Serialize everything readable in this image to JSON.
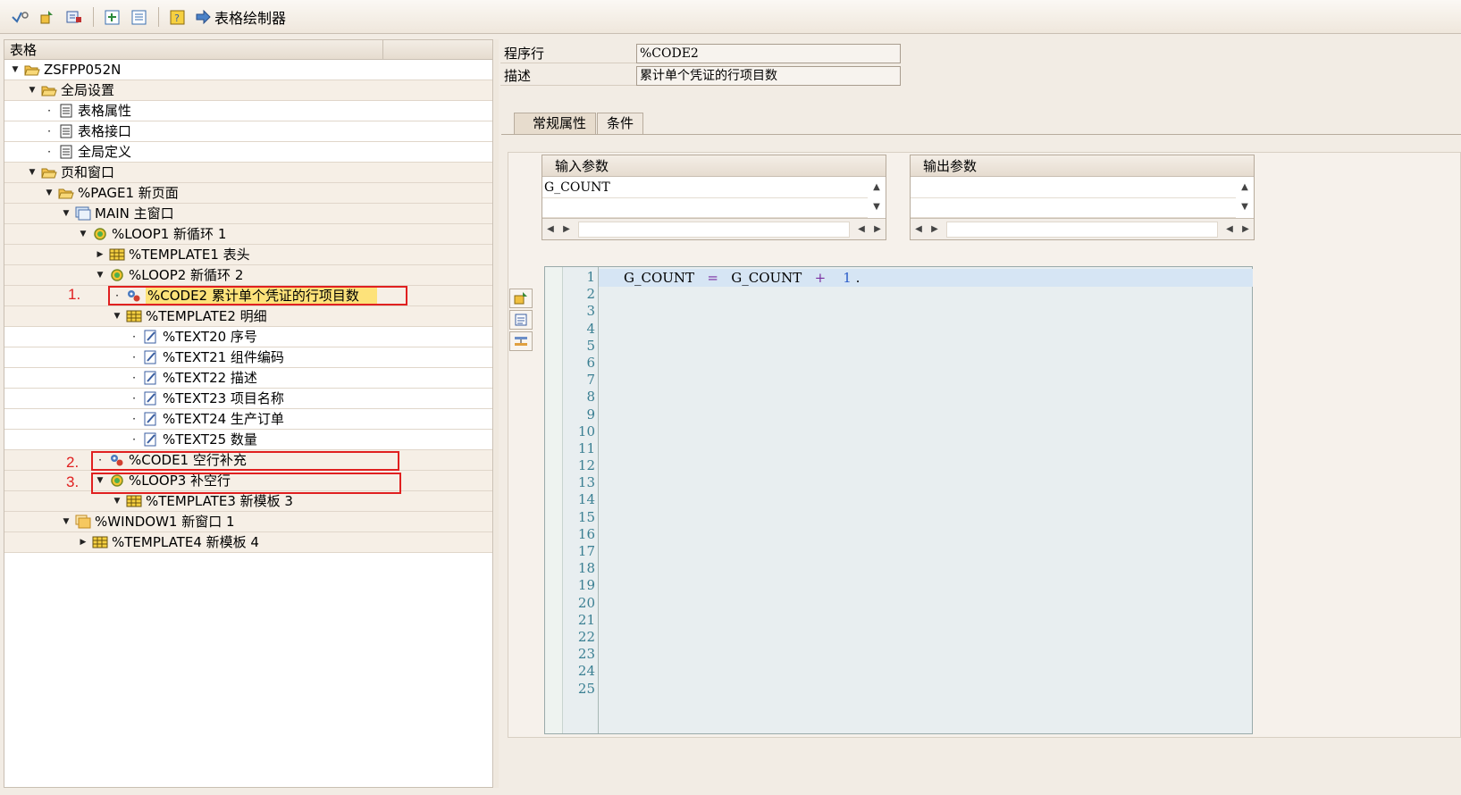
{
  "toolbar": {
    "painter_label": "表格绘制器"
  },
  "tree": {
    "header": "表格",
    "rows": [
      {
        "label": "ZSFPP052N",
        "indent": 0,
        "exp": "open",
        "icon": "folder-open-icon",
        "shade": false
      },
      {
        "label": "全局设置",
        "indent": 1,
        "exp": "open",
        "icon": "folder-open-icon",
        "shade": true
      },
      {
        "label": "表格属性",
        "indent": 2,
        "exp": "leaf",
        "icon": "document-icon",
        "shade": false
      },
      {
        "label": "表格接口",
        "indent": 2,
        "exp": "leaf",
        "icon": "document-icon",
        "shade": false
      },
      {
        "label": "全局定义",
        "indent": 2,
        "exp": "leaf",
        "icon": "document-icon",
        "shade": false
      },
      {
        "label": "页和窗口",
        "indent": 1,
        "exp": "open",
        "icon": "folder-open-icon",
        "shade": true
      },
      {
        "label": "%PAGE1 新页面",
        "indent": 2,
        "exp": "open",
        "icon": "folder-open-icon",
        "shade": true
      },
      {
        "label": "MAIN 主窗口",
        "indent": 3,
        "exp": "open",
        "icon": "window-icon",
        "shade": true
      },
      {
        "label": "%LOOP1 新循环 1",
        "indent": 4,
        "exp": "open",
        "icon": "loop-icon",
        "shade": true
      },
      {
        "label": "%TEMPLATE1 表头",
        "indent": 5,
        "exp": "closed",
        "icon": "table-icon",
        "shade": true
      },
      {
        "label": "%LOOP2 新循环 2",
        "indent": 5,
        "exp": "open",
        "icon": "loop-icon",
        "shade": true
      },
      {
        "label": "%CODE2 累计单个凭证的行项目数",
        "indent": 6,
        "exp": "leaf",
        "icon": "code-icon",
        "shade": true,
        "selected": true
      },
      {
        "label": "%TEMPLATE2 明细",
        "indent": 6,
        "exp": "open",
        "icon": "table-icon",
        "shade": true
      },
      {
        "label": "%TEXT20 序号",
        "indent": 7,
        "exp": "leaf",
        "icon": "text-icon",
        "shade": false
      },
      {
        "label": "%TEXT21 组件编码",
        "indent": 7,
        "exp": "leaf",
        "icon": "text-icon",
        "shade": false
      },
      {
        "label": "%TEXT22 描述",
        "indent": 7,
        "exp": "leaf",
        "icon": "text-icon",
        "shade": false
      },
      {
        "label": "%TEXT23 项目名称",
        "indent": 7,
        "exp": "leaf",
        "icon": "text-icon",
        "shade": false
      },
      {
        "label": "%TEXT24 生产订单",
        "indent": 7,
        "exp": "leaf",
        "icon": "text-icon",
        "shade": false
      },
      {
        "label": "%TEXT25 数量",
        "indent": 7,
        "exp": "leaf",
        "icon": "text-icon",
        "shade": false
      },
      {
        "label": "%CODE1 空行补充",
        "indent": 5,
        "exp": "leaf",
        "icon": "code-icon",
        "shade": true
      },
      {
        "label": "%LOOP3 补空行",
        "indent": 5,
        "exp": "open",
        "icon": "loop-icon",
        "shade": true
      },
      {
        "label": "%TEMPLATE3 新模板 3",
        "indent": 6,
        "exp": "open",
        "icon": "table-icon",
        "shade": true
      },
      {
        "label": "%WINDOW1 新窗口 1",
        "indent": 3,
        "exp": "open",
        "icon": "window-folder-icon",
        "shade": true
      },
      {
        "label": "%TEMPLATE4 新模板 4",
        "indent": 4,
        "exp": "closed",
        "icon": "table-icon",
        "shade": true
      }
    ]
  },
  "annotations": {
    "n1": "1.",
    "n2": "2.",
    "n3": "3."
  },
  "fields": {
    "program_line_label": "程序行",
    "program_line_value": "%CODE2",
    "description_label": "描述",
    "description_value": "累计单个凭证的行项目数"
  },
  "tabs": {
    "general": "常规属性",
    "conditions": "条件"
  },
  "params": {
    "input_header": "输入参数",
    "input_values": [
      "G_COUNT"
    ],
    "output_header": "输出参数"
  },
  "editor": {
    "code_tokens": {
      "var1": "G_COUNT",
      "eq": "=",
      "var2": "G_COUNT",
      "plus": "+",
      "num": "1",
      "end": "."
    },
    "line_numbers": [
      "1",
      "2",
      "3",
      "4",
      "5",
      "6",
      "7",
      "8",
      "9",
      "10",
      "11",
      "12",
      "13",
      "14",
      "15",
      "16",
      "17",
      "18",
      "19",
      "20",
      "21",
      "22",
      "23",
      "24",
      "25"
    ]
  }
}
